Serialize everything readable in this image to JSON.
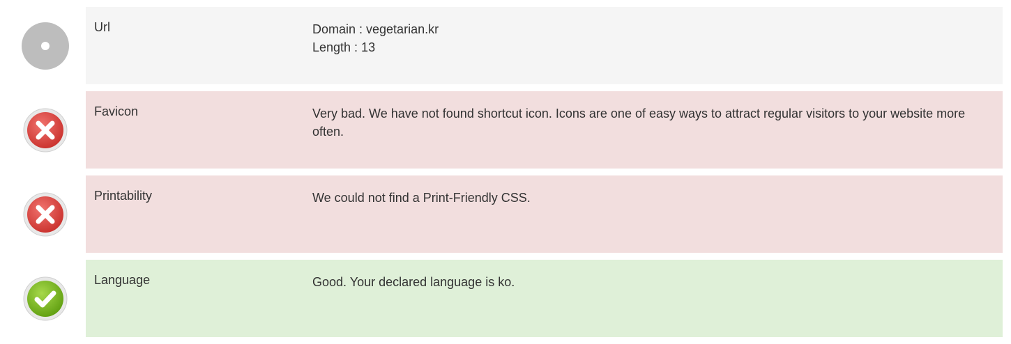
{
  "rows": [
    {
      "status": "neutral",
      "icon": "info-circle-icon",
      "label": "Url",
      "lines": [
        "Domain : vegetarian.kr",
        "Length : 13"
      ]
    },
    {
      "status": "bad",
      "icon": "error-x-icon",
      "label": "Favicon",
      "lines": [
        "Very bad. We have not found shortcut icon. Icons are one of easy ways to attract regular visitors to your website more often."
      ]
    },
    {
      "status": "bad",
      "icon": "error-x-icon",
      "label": "Printability",
      "lines": [
        "We could not find a Print-Friendly CSS."
      ]
    },
    {
      "status": "good",
      "icon": "check-circle-icon",
      "label": "Language",
      "lines": [
        "Good. Your declared language is ko."
      ]
    }
  ],
  "colors": {
    "neutral_bg": "#f5f5f5",
    "bad_bg": "#f2dede",
    "good_bg": "#dff0d8",
    "error_red": "#d9534f",
    "ok_green": "#7dbb1f",
    "neutral_gray": "#bdbdbd"
  }
}
